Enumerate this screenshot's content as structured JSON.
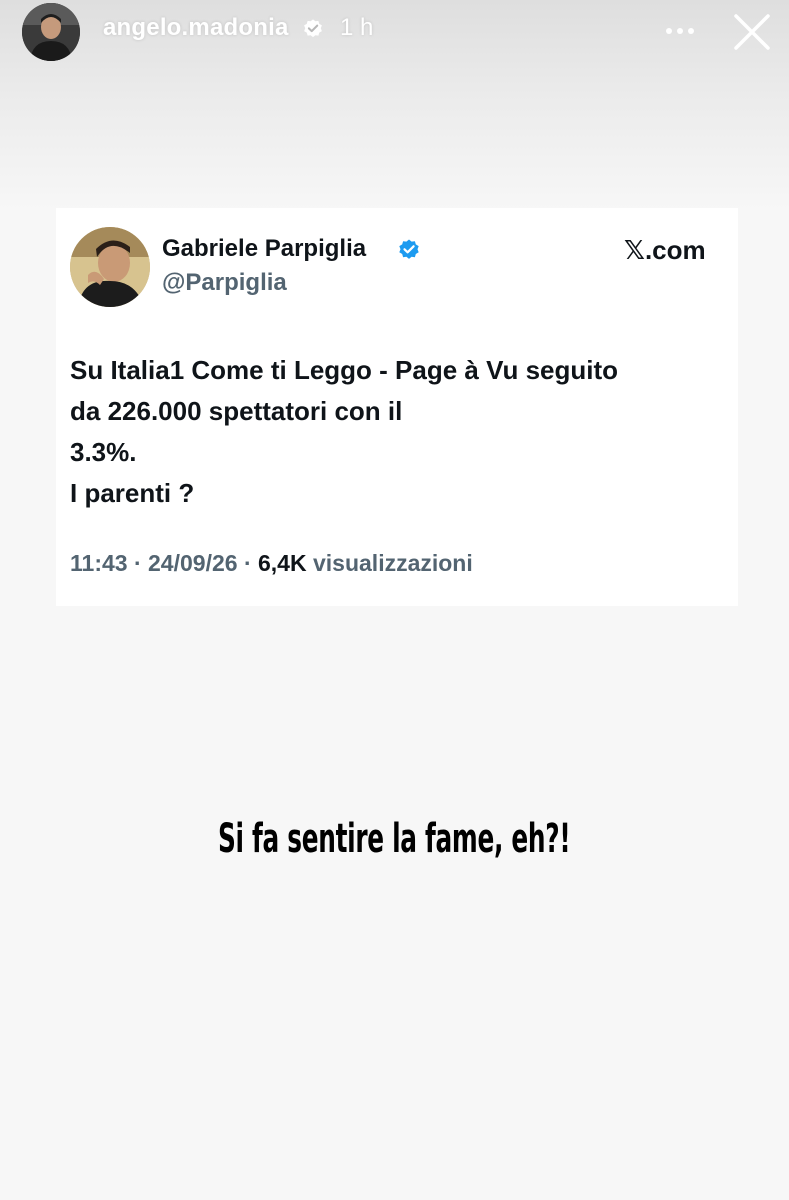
{
  "story": {
    "username": "angelo.madonia",
    "time": "1 h",
    "caption": "Si fa sentire la fame, eh?!"
  },
  "tweet": {
    "name": "Gabriele Parpiglia",
    "handle": "@Parpiglia",
    "source_domain": ".com",
    "source_glyph": "𝕏",
    "text_lines": [
      "Su Italia1 Come ti Leggo - Page à Vu seguito",
      "da 226.000 spettatori con il",
      "3.3%.",
      "I parenti ?"
    ],
    "time": "11:43",
    "date": "24/09/26",
    "views_count": "6,4K",
    "views_label": "visualizzazioni",
    "separator": "·"
  },
  "colors": {
    "background": "#f7f7f7",
    "verified_blue": "#1d9bf0",
    "tweet_text": "#0f1419",
    "tweet_secondary": "#536471"
  },
  "icons": {
    "story_verified": "verified-badge-icon",
    "more": "more-horizontal-icon",
    "close": "close-icon",
    "tweet_verified": "verified-badge-icon"
  }
}
